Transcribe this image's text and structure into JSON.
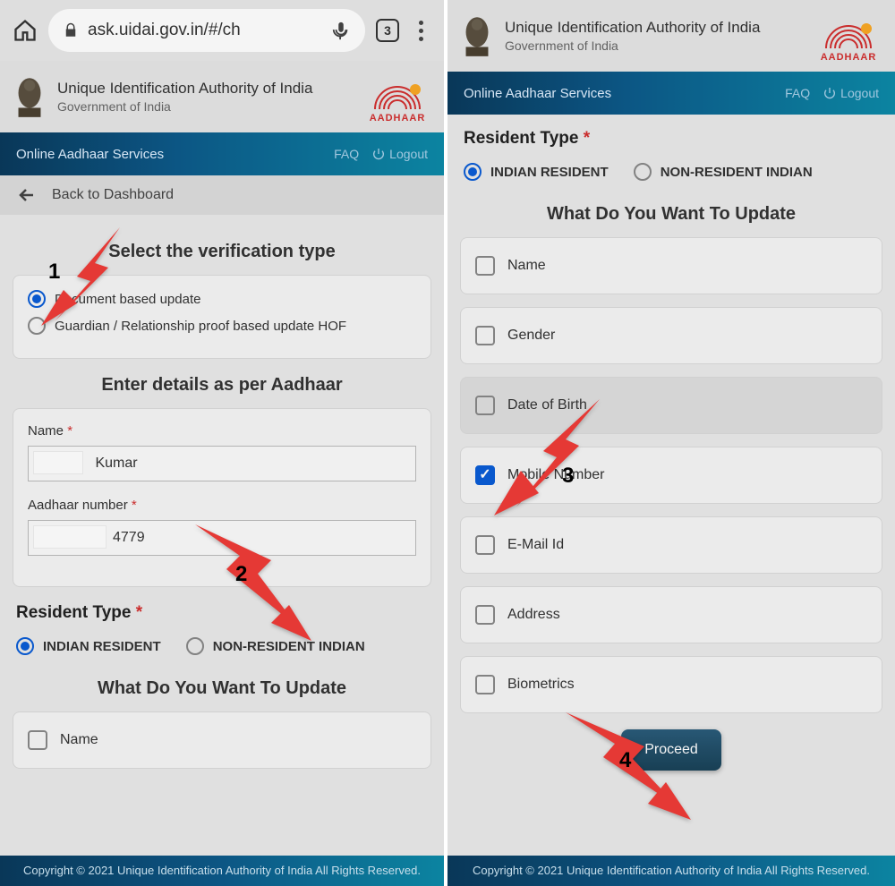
{
  "chrome": {
    "url": "ask.uidai.gov.in/#/ch",
    "tab_count": "3"
  },
  "site": {
    "title": "Unique Identification Authority of India",
    "subtitle": "Government of India",
    "logo_text": "AADHAAR"
  },
  "nav": {
    "title": "Online Aadhaar Services",
    "faq": "FAQ",
    "logout": "Logout"
  },
  "breadcrumb": {
    "label": "Back to Dashboard"
  },
  "left": {
    "verify_title": "Select the verification type",
    "verify_opts": [
      "Document based update",
      "Guardian / Relationship proof based update HOF"
    ],
    "details_title": "Enter details as per Aadhaar",
    "name_label": "Name",
    "name_value": " Kumar",
    "aadhaar_label": "Aadhaar number",
    "aadhaar_value": "4779",
    "resident_title": "Resident Type",
    "resident_opts": [
      "INDIAN RESIDENT",
      "NON-RESIDENT INDIAN"
    ],
    "update_title": "What Do You Want To Update",
    "update_name": "Name"
  },
  "right": {
    "resident_title": "Resident Type",
    "resident_opts": [
      "INDIAN RESIDENT",
      "NON-RESIDENT INDIAN"
    ],
    "update_title": "What Do You Want To Update",
    "options": [
      {
        "label": "Name",
        "checked": false
      },
      {
        "label": "Gender",
        "checked": false
      },
      {
        "label": "Date of Birth",
        "checked": false
      },
      {
        "label": "Mobile Number",
        "checked": true
      },
      {
        "label": "E-Mail Id",
        "checked": false
      },
      {
        "label": "Address",
        "checked": false
      },
      {
        "label": "Biometrics",
        "checked": false
      }
    ],
    "proceed": "Proceed"
  },
  "footer": "Copyright © 2021 Unique Identification Authority of India All Rights Reserved.",
  "arrows": [
    "1",
    "2",
    "3",
    "4"
  ]
}
